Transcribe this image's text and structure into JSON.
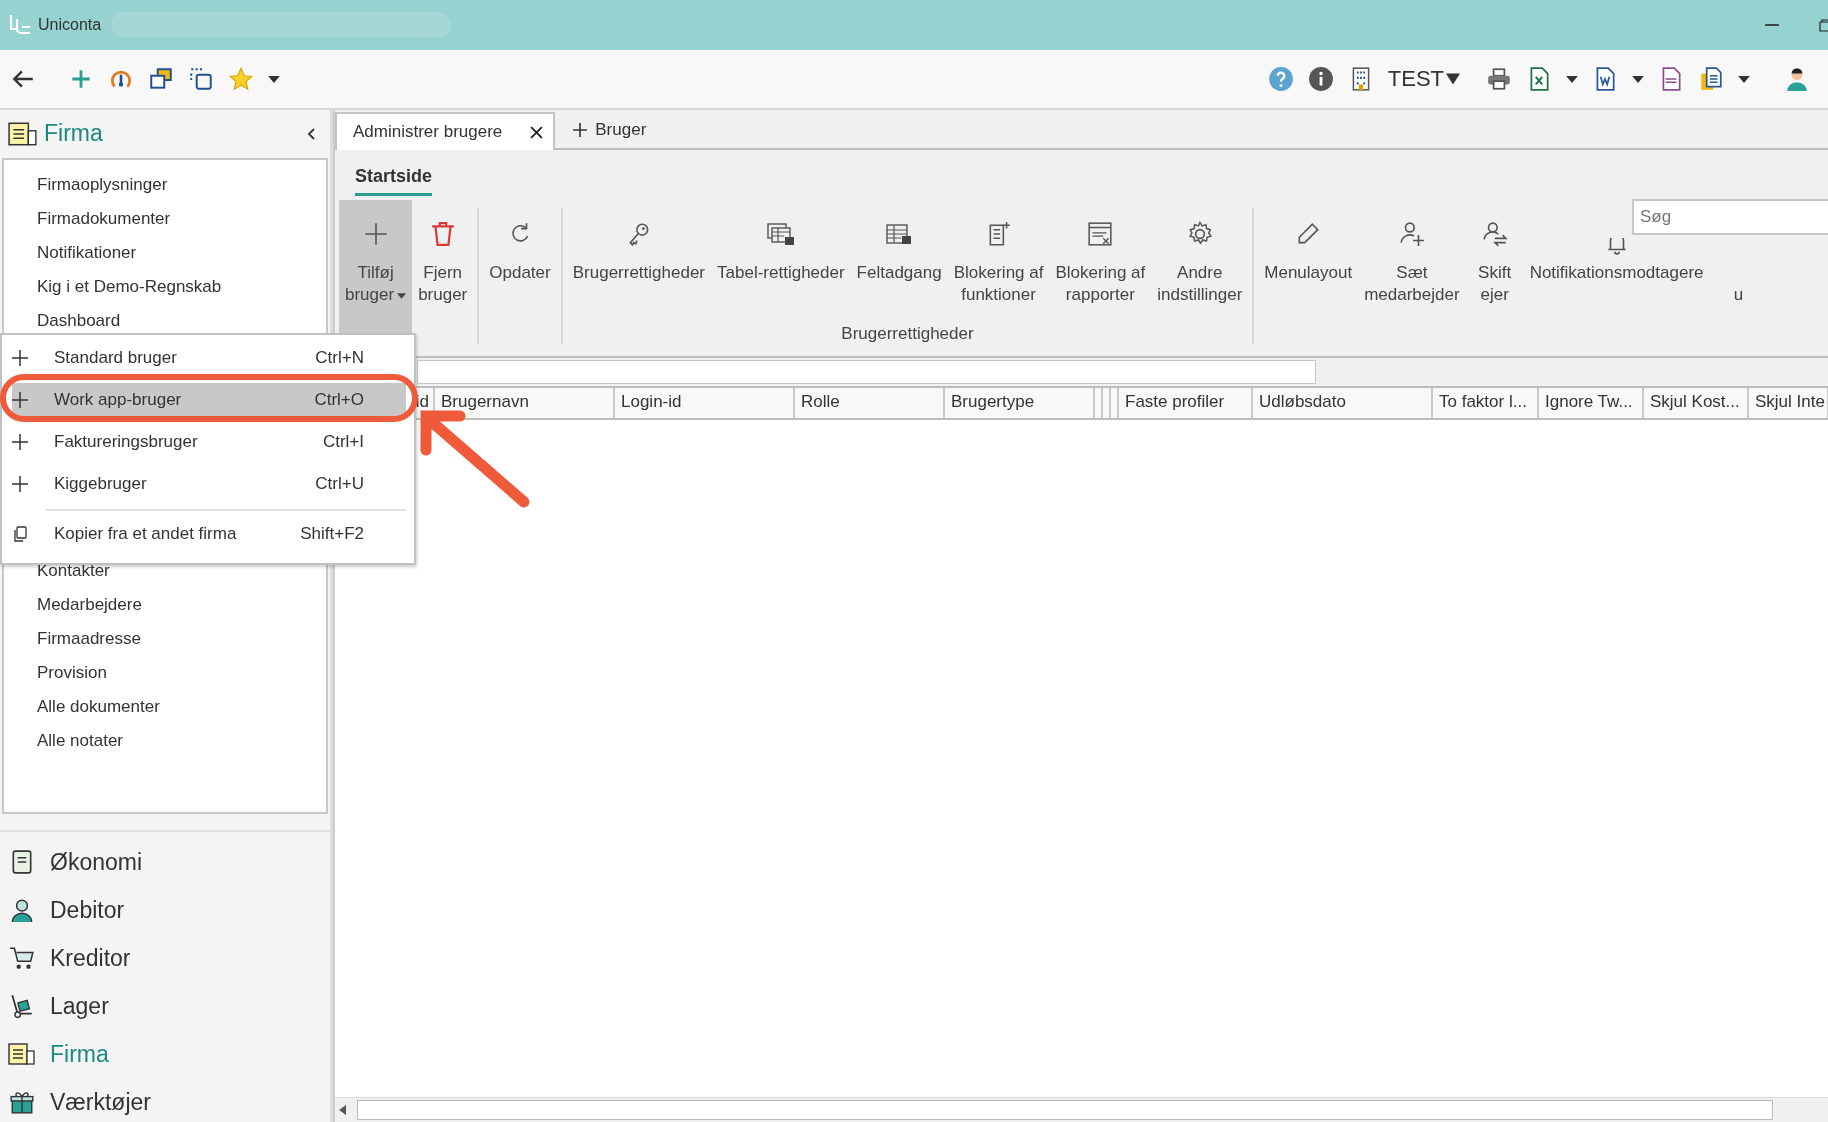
{
  "window": {
    "title": "Uniconta"
  },
  "toolbar": {
    "company": "TEST"
  },
  "sidebar": {
    "title": "Firma",
    "items": [
      {
        "label": "Firmaoplysninger"
      },
      {
        "label": "Firmadokumenter"
      },
      {
        "label": "Notifikationer"
      },
      {
        "label": "Kig i et Demo-Regnskab"
      },
      {
        "label": "Dashboard"
      }
    ],
    "items_after_menu": [
      {
        "label": "Kontakter"
      },
      {
        "label": "Medarbejdere"
      },
      {
        "label": "Firmaadresse"
      },
      {
        "label": "Provision"
      },
      {
        "label": "Alle dokumenter"
      },
      {
        "label": "Alle notater"
      }
    ],
    "modules": [
      {
        "label": "Økonomi",
        "kind": "book",
        "selected": false
      },
      {
        "label": "Debitor",
        "kind": "person",
        "selected": false
      },
      {
        "label": "Kreditor",
        "kind": "cart",
        "selected": false
      },
      {
        "label": "Lager",
        "kind": "truck",
        "selected": false
      },
      {
        "label": "Firma",
        "kind": "company",
        "selected": true
      },
      {
        "label": "Værktøjer",
        "kind": "gift",
        "selected": false
      }
    ]
  },
  "tabs": [
    {
      "label": "Administrer brugere",
      "selected": true
    }
  ],
  "new_tab": {
    "label": "Bruger"
  },
  "ribbon": {
    "tab": "Startside",
    "groups": [
      {
        "buttons": [
          {
            "label": "Tilføj\nbruger",
            "kind": "plus",
            "pressed": true,
            "dropdown": true
          },
          {
            "label": "Fjern\nbruger",
            "kind": "trash",
            "pressed": false,
            "dropdown": false
          }
        ]
      },
      {
        "buttons": [
          {
            "label": "Opdater",
            "kind": "refresh",
            "pressed": false,
            "dropdown": false
          }
        ]
      },
      {
        "label": "Brugerrettigheder",
        "buttons": [
          {
            "label": "Brugerrettigheder",
            "kind": "key",
            "pressed": false,
            "dropdown": false
          },
          {
            "label": "Tabel-rettigheder",
            "kind": "tables",
            "pressed": false,
            "dropdown": false
          },
          {
            "label": "Feltadgang",
            "kind": "table",
            "pressed": false,
            "dropdown": false
          },
          {
            "label": "Blokering af\nfunktioner",
            "kind": "docplus",
            "pressed": false,
            "dropdown": false
          },
          {
            "label": "Blokering af\nrapporter",
            "kind": "report",
            "pressed": false,
            "dropdown": false
          },
          {
            "label": "Andre\nindstillinger",
            "kind": "gear",
            "pressed": false,
            "dropdown": false
          }
        ]
      },
      {
        "buttons": [
          {
            "label": "Menulayout",
            "kind": "pencil",
            "pressed": false,
            "dropdown": false
          },
          {
            "label": "Sæt\nmedarbejder",
            "kind": "userplus",
            "pressed": false,
            "dropdown": false
          },
          {
            "label": "Skift\nejer",
            "kind": "userswap",
            "pressed": false,
            "dropdown": false
          },
          {
            "label": "Notifikationsmodtagere",
            "kind": "bell",
            "pressed": false,
            "dropdown": false
          },
          {
            "label": "\nu",
            "kind": "none",
            "pressed": false,
            "dropdown": false
          }
        ]
      }
    ]
  },
  "search": {
    "placeholder": "Søg"
  },
  "table": {
    "columns": [
      "id",
      "Brugernavn",
      "Login-id",
      "Rolle",
      "Brugertype",
      "",
      "",
      "",
      "Faste profiler",
      "Udløbsdato",
      "To faktor l...",
      "Ignore Tw...",
      "Skjul Kost...",
      "Skjul Inte"
    ]
  },
  "dropdown_menu": {
    "items": [
      {
        "label": "Standard bruger",
        "shortcut": "Ctrl+N",
        "kind": "plus",
        "selected": false,
        "divider_above": false
      },
      {
        "label": "Work app-bruger",
        "shortcut": "Ctrl+O",
        "kind": "plus",
        "selected": true,
        "divider_above": false
      },
      {
        "label": "Faktureringsbruger",
        "shortcut": "Ctrl+I",
        "kind": "plus",
        "selected": false,
        "divider_above": false
      },
      {
        "label": "Kiggebruger",
        "shortcut": "Ctrl+U",
        "kind": "plus",
        "selected": false,
        "divider_above": false
      },
      {
        "label": "Kopier fra et andet firma",
        "shortcut": "Shift+F2",
        "kind": "copy",
        "selected": false,
        "divider_above": true
      }
    ]
  }
}
